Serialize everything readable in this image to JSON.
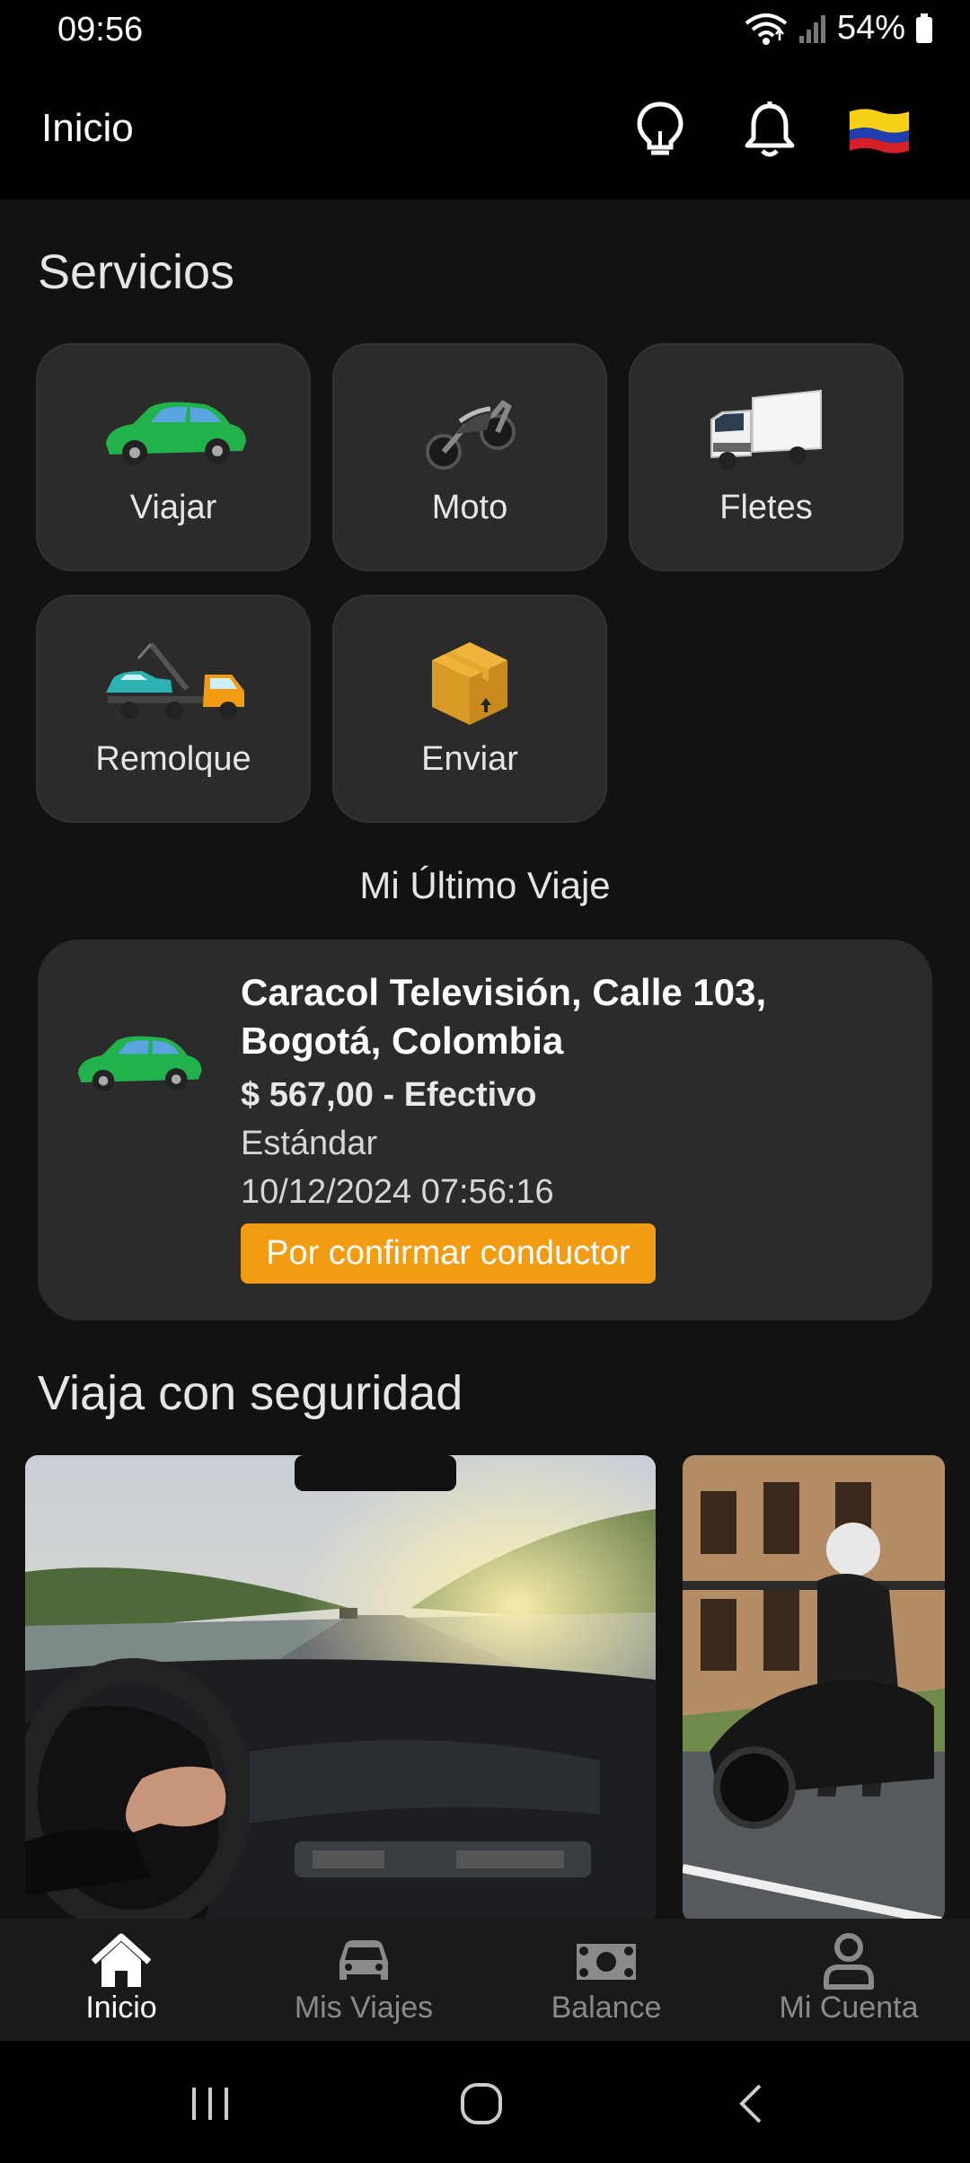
{
  "status_bar": {
    "time": "09:56",
    "battery": "54%"
  },
  "app_bar": {
    "title": "Inicio",
    "icons": [
      "lightbulb-icon",
      "bell-icon",
      "colombia-flag-icon"
    ]
  },
  "services": {
    "title": "Servicios",
    "items": [
      {
        "label": "Viajar",
        "icon": "green-car-icon"
      },
      {
        "label": "Moto",
        "icon": "motorcycle-icon"
      },
      {
        "label": "Fletes",
        "icon": "truck-icon"
      },
      {
        "label": "Remolque",
        "icon": "tow-truck-icon"
      },
      {
        "label": "Enviar",
        "icon": "package-icon"
      }
    ]
  },
  "last_trip": {
    "title": "Mi Último Viaje",
    "address": "Caracol Televisión, Calle 103, Bogotá, Colombia",
    "price": "$ 567,00 - Efectivo",
    "type": "Estándar",
    "date": "10/12/2024 07:56:16",
    "status": "Por confirmar conductor"
  },
  "safety": {
    "title": "Viaja con seguridad"
  },
  "bottom_nav": {
    "items": [
      {
        "label": "Inicio",
        "icon": "home-icon",
        "active": true
      },
      {
        "label": "Mis Viajes",
        "icon": "car-icon",
        "active": false
      },
      {
        "label": "Balance",
        "icon": "cash-icon",
        "active": false
      },
      {
        "label": "Mi Cuenta",
        "icon": "user-icon",
        "active": false
      }
    ]
  },
  "colors": {
    "accent": "#f39c12",
    "card": "#2b2b2b",
    "background": "#121212"
  }
}
